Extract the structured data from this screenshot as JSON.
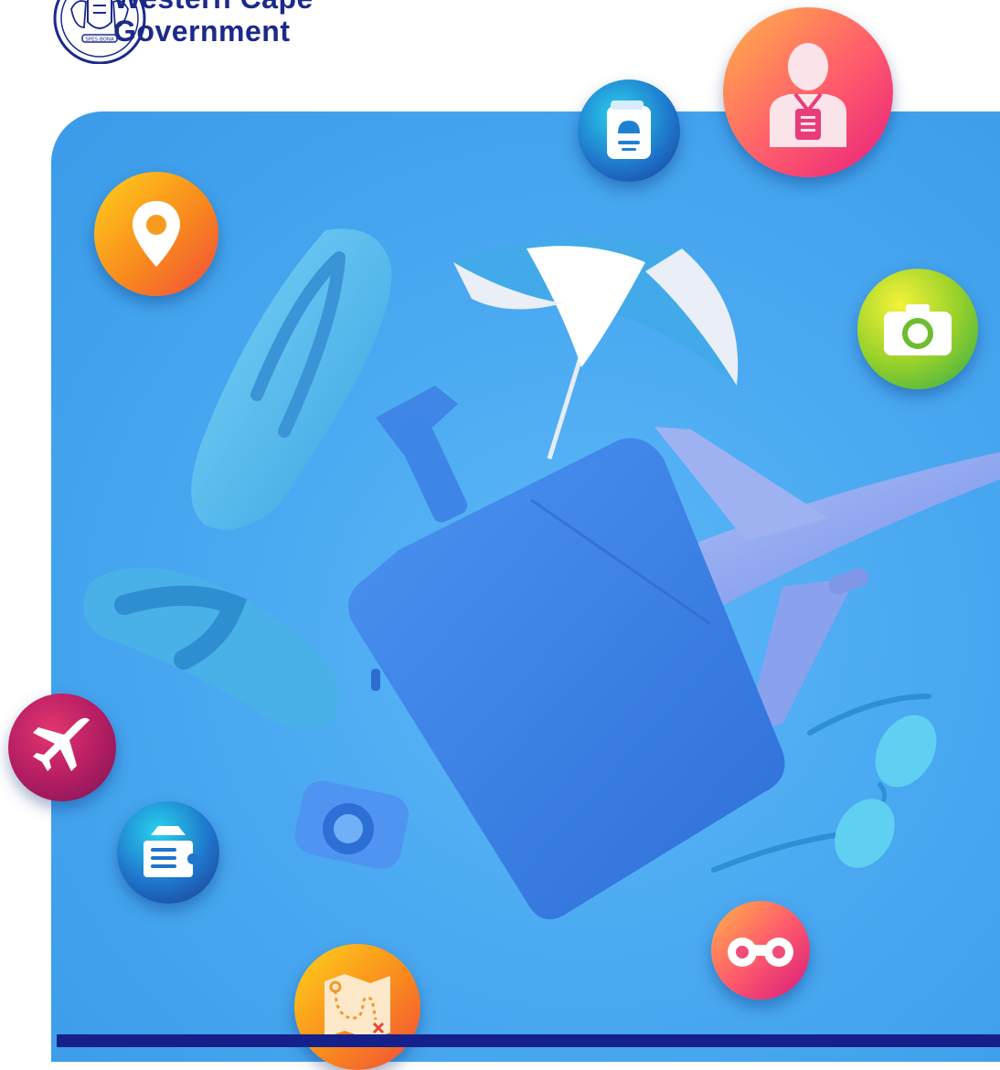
{
  "brand": {
    "line1": "Western Cape",
    "line2": "Government",
    "crest_motto": "SPES BONA"
  },
  "icons": {
    "location": "map-pin-icon",
    "passport": "passport-icon",
    "tour_guide": "tour-guide-icon",
    "camera": "camera-icon",
    "plane": "airplane-icon",
    "ticket": "ticket-icon",
    "map": "treasure-map-icon",
    "binoculars": "binoculars-icon"
  },
  "colors": {
    "brand_navy": "#1b2a8a",
    "hero_blue": "#4aa9f1",
    "footer_bar": "#16208a"
  }
}
